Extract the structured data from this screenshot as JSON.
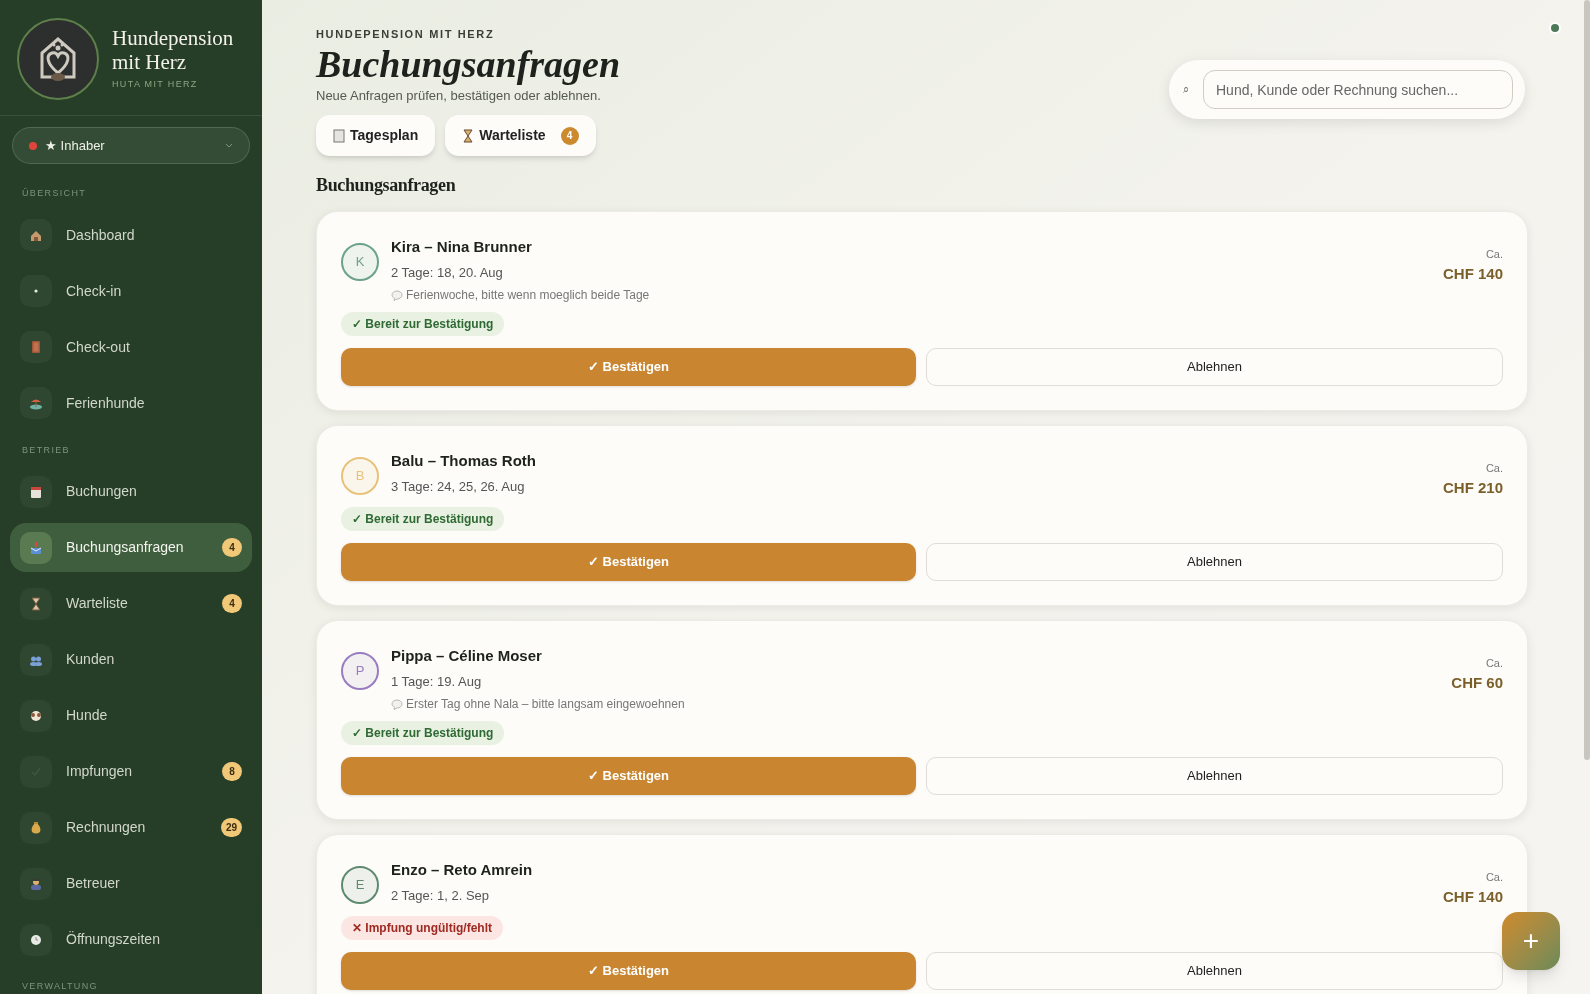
{
  "sidebar": {
    "brand": {
      "title": "Hundepension mit Herz",
      "subtitle": "HUTA MIT HERZ"
    },
    "role": {
      "label": "★ Inhaber"
    },
    "sections": [
      {
        "label": "ÜBERSICHT",
        "items": [
          {
            "label": "Dashboard",
            "selected": false
          },
          {
            "label": "Check-in",
            "selected": false
          },
          {
            "label": "Check-out",
            "selected": false
          },
          {
            "label": "Ferienhunde",
            "selected": false
          }
        ]
      },
      {
        "label": "BETRIEB",
        "items": [
          {
            "label": "Buchungen",
            "selected": false
          },
          {
            "label": "Buchungsanfragen",
            "selected": true,
            "badge": "4"
          },
          {
            "label": "Warteliste",
            "selected": false,
            "badge": "4"
          },
          {
            "label": "Kunden",
            "selected": false
          },
          {
            "label": "Hunde",
            "selected": false
          },
          {
            "label": "Impfungen",
            "selected": false,
            "badge": "8"
          },
          {
            "label": "Rechnungen",
            "selected": false,
            "badge": "29"
          },
          {
            "label": "Betreuer",
            "selected": false
          },
          {
            "label": "Öffnungszeiten",
            "selected": false
          }
        ]
      },
      {
        "label": "VERWALTUNG"
      }
    ]
  },
  "header": {
    "eyebrow": "HUNDEPENSION MIT HERZ",
    "title": "Buchungsanfragen",
    "subtitle": "Neue Anfragen prüfen, bestätigen oder ablehnen."
  },
  "search": {
    "icon": "⌕",
    "placeholder": "Hund, Kunde oder Rechnung suchen..."
  },
  "quick_tabs": [
    {
      "label": "Tagesplan"
    },
    {
      "label": "Warteliste",
      "badge": "4"
    }
  ],
  "section_title": "Buchungsanfragen",
  "requests": [
    {
      "initial": "K",
      "color": "#6aa28a",
      "name": "Kira – Nina Brunner",
      "days": "2 Tage: 18, 20. Aug",
      "note": "Ferienwoche, bitte wenn moeglich beide Tage",
      "status": {
        "kind": "ready",
        "label": "✓ Bereit zur Bestätigung"
      },
      "price_label": "Ca.",
      "price": "CHF 140",
      "confirm": "✓ Bestätigen",
      "reject": "Ablehnen"
    },
    {
      "initial": "B",
      "color": "#e8c27a",
      "name": "Balu – Thomas Roth",
      "days": "3 Tage: 24, 25, 26. Aug",
      "status": {
        "kind": "ready",
        "label": "✓ Bereit zur Bestätigung"
      },
      "price_label": "Ca.",
      "price": "CHF 210",
      "confirm": "✓ Bestätigen",
      "reject": "Ablehnen"
    },
    {
      "initial": "P",
      "color": "#9a7cc0",
      "name": "Pippa – Céline Moser",
      "days": "1 Tage: 19. Aug",
      "note": "Erster Tag ohne Nala – bitte langsam eingewoehnen",
      "status": {
        "kind": "ready",
        "label": "✓ Bereit zur Bestätigung"
      },
      "price_label": "Ca.",
      "price": "CHF 60",
      "confirm": "✓ Bestätigen",
      "reject": "Ablehnen"
    },
    {
      "initial": "E",
      "color": "#5f8a70",
      "name": "Enzo – Reto Amrein",
      "days": "2 Tage: 1, 2. Sep",
      "status": {
        "kind": "invalid",
        "label": "✕ Impfung ungültig/fehlt"
      },
      "price_label": "Ca.",
      "price": "CHF 140",
      "confirm": "✓ Bestätigen",
      "reject": "Ablehnen"
    }
  ],
  "fab": {
    "label": "+"
  }
}
